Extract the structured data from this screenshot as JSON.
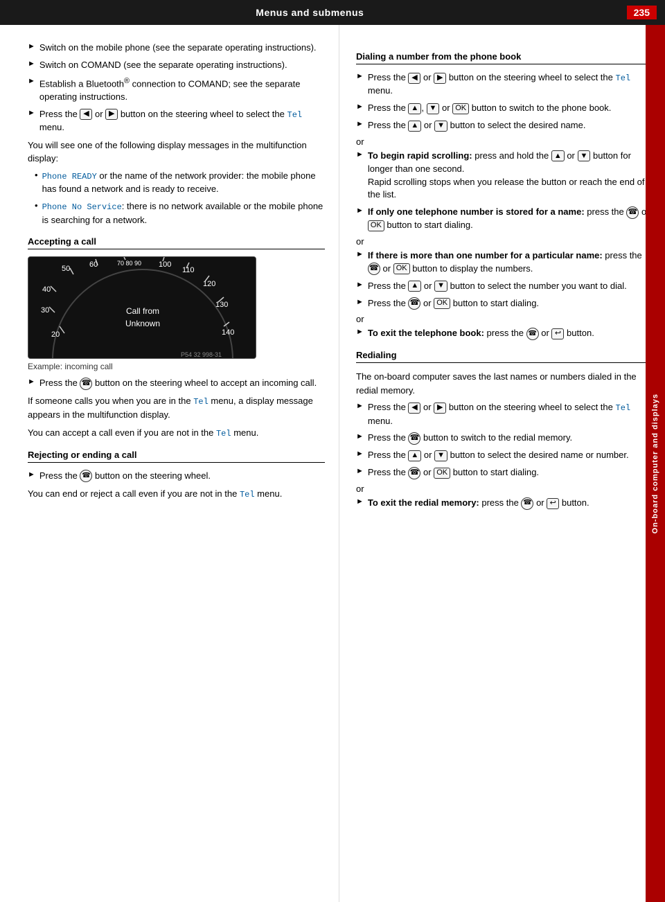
{
  "header": {
    "title": "Menus and submenus",
    "page_number": "235"
  },
  "side_tab": {
    "text": "On-board computer and displays"
  },
  "left_col": {
    "bullets": [
      "Switch on the mobile phone (see the separate operating instructions).",
      "Switch on COMAND (see the separate operating instructions).",
      "Establish a Bluetooth® connection to COMAND; see the separate operating instructions.",
      "Press the  or  button on the steering wheel to select the Tel menu."
    ],
    "intro_text": "You will see one of the following display messages in the multifunction display:",
    "dot_items": [
      {
        "label": "Phone READY",
        "text": " or the name of the network provider: the mobile phone has found a network and is ready to receive."
      },
      {
        "label": "Phone No Service",
        "text": ": there is no network available or the mobile phone is searching for a network."
      }
    ],
    "accepting_call": {
      "heading": "Accepting a call",
      "speedo_caption": "Example: incoming call",
      "speedo_numbers": [
        "60",
        "70 80 90",
        "100",
        "50",
        "110",
        "40",
        "120",
        "30",
        "130",
        "20",
        "140"
      ],
      "call_text": "Call from",
      "unknown_text": "Unknown",
      "img_code": "P54 32 998-31",
      "bullet1": "Press the  button on the steering wheel to accept an incoming call.",
      "para1": "If someone calls you when you are in the Tel menu, a display message appears in the multifunction display.",
      "para2": "You can accept a call even if you are not in the Tel menu."
    },
    "rejecting": {
      "heading": "Rejecting or ending a call",
      "bullet1": "Press the  button on the steering wheel.",
      "para1": "You can end or reject a call even if you are not in the Tel menu."
    }
  },
  "right_col": {
    "dialing_heading": "Dialing a number from the phone book",
    "dialing_bullets": [
      {
        "id": 1,
        "text": "Press the  or  button on the steering wheel to select the Tel menu."
      },
      {
        "id": 2,
        "text": "Press the ,  or  button to switch to the phone book."
      },
      {
        "id": 3,
        "text": "Press the  or  button to select the desired name."
      }
    ],
    "or1": "or",
    "rapid_scroll": {
      "bold_prefix": "To begin rapid scrolling:",
      "text": " press and hold the  or  button for longer than one second.",
      "note": "Rapid scrolling stops when you release the button or reach the end of the list."
    },
    "only_one": {
      "bold_text": "If only one telephone number is stored for a name:",
      "text": " press the  or  button to start dialing."
    },
    "or2": "or",
    "more_than_one": {
      "bold_text": "If there is more than one number for a particular name:",
      "text": " press the  or  button to display the numbers."
    },
    "then_bullets": [
      {
        "text": "Press the  or  button to select the number you want to dial."
      },
      {
        "text": "Press the  or  button to start dialing."
      }
    ],
    "or3": "or",
    "exit_phone": {
      "bold_text": "To exit the telephone book:",
      "text": " press the  or  button."
    },
    "redialing_heading": "Redialing",
    "redialing_intro": "The on-board computer saves the last names or numbers dialed in the redial memory.",
    "redialing_bullets": [
      {
        "text": "Press the  or  button on the steering wheel to select the Tel menu."
      },
      {
        "text": "Press the  button to switch to the redial memory."
      },
      {
        "text": "Press the  or  button to select the desired name or number."
      },
      {
        "text": "Press the  or  button to start dialing."
      }
    ],
    "or4": "or",
    "exit_redial": {
      "bold_text": "To exit the redial memory:",
      "text": " press the  or  button."
    }
  }
}
